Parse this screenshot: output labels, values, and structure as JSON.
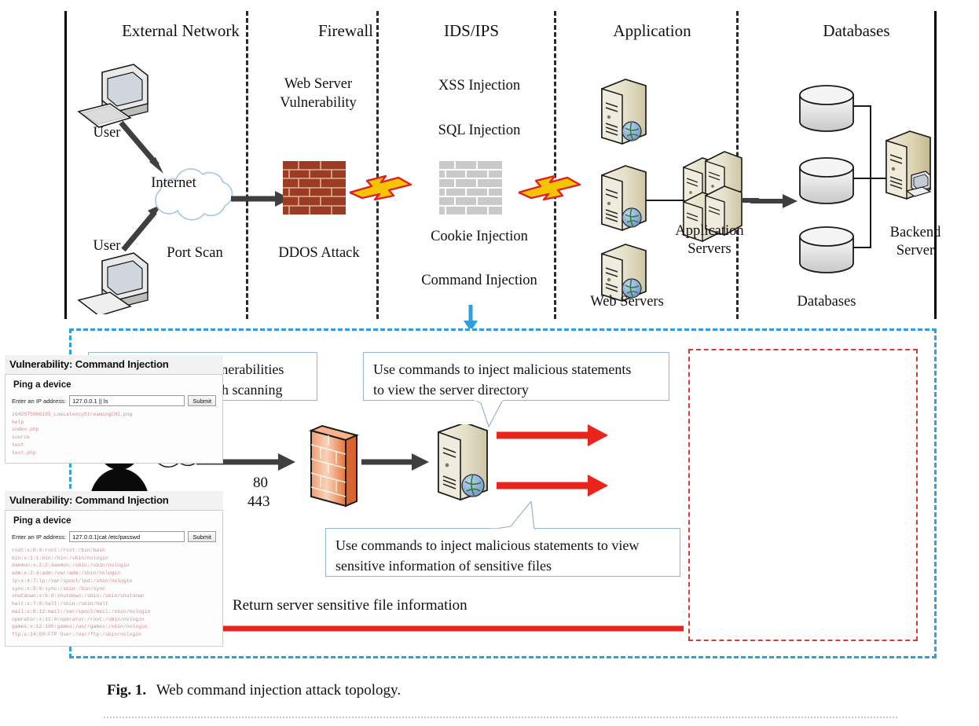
{
  "figure": {
    "label": "Fig. 1",
    "caption": "Web command injection attack topology."
  },
  "top_diagram": {
    "zones": [
      {
        "title": "External Network"
      },
      {
        "title": "Firewall"
      },
      {
        "title": "IDS/IPS"
      },
      {
        "title": "Application"
      },
      {
        "title": "Databases"
      }
    ],
    "labels": {
      "user_top": "User",
      "user_bottom": "User",
      "internet": "Internet",
      "port_scan": "Port Scan",
      "web_server_vulnerability_l1": "Web Server",
      "web_server_vulnerability_l2": "Vulnerability",
      "ddos_attack": "DDOS Attack",
      "xss_injection": "XSS  Injection",
      "sql_injection": "SQL Injection",
      "cookie_injection": "Cookie Injection",
      "command_injection": "Command Injection",
      "web_servers": "Web Servers",
      "application_servers_l1": "Application",
      "application_servers_l2": "Servers",
      "databases": "Databases",
      "backend_server_l1": "Backend",
      "backend_server_l2": "Server"
    }
  },
  "bottom_diagram": {
    "callouts": {
      "scanning_l1": "Attackers learn of vulnerabilities",
      "scanning_l2": "in applications through scanning",
      "directory_l1": "Use commands to inject malicious statements",
      "directory_l2": "to view the server directory",
      "sensitive_l1": "Use commands to inject malicious statements to view",
      "sensitive_l2": "sensitive information of sensitive files"
    },
    "labels": {
      "hacker": "Hacker",
      "port_80": "80",
      "port_443": "443",
      "return_info": "Return server sensitive file information"
    }
  },
  "vulnerability_panels": [
    {
      "title": "Vulnerability: Command Injection",
      "subtitle": "Ping a device",
      "field_label": "Enter an IP address:",
      "field_value": "127.0.0.1 || ls",
      "submit_label": "Submit",
      "output": "1642575066185_LowLatencyStreamingCHI.png\nhelp\nindex.php\nsource\ntest\ntest.php"
    },
    {
      "title": "Vulnerability: Command Injection",
      "subtitle": "Ping a device",
      "field_label": "Enter an IP address:",
      "field_value": "127.0.0.1|cat /etc/passwd",
      "submit_label": "Submit",
      "output": "root:x:0:0:root:/root:/bin/bash\nbin:x:1:1:bin:/bin:/sbin/nologin\ndaemon:x:2:2:daemon:/sbin:/sbin/nologin\nadm:x:3:4:adm:/var/adm:/sbin/nologin\nlp:x:4:7:lp:/var/spool/lpd:/sbin/nologin\nsync:x:5:0:sync:/sbin:/bin/sync\nshutdown:x:6:0:shutdown:/sbin:/sbin/shutdown\nhalt:x:7:0:halt:/sbin:/sbin/halt\nmail:x:8:12:mail:/var/spool/mail:/sbin/nologin\noperator:x:11:0:operator:/root:/sbin/nologin\ngames:x:12:100:games:/usr/games:/sbin/nologin\nftp:x:14:50:FTP User:/var/ftp:/sbin/nologin"
    }
  ],
  "colors": {
    "panel_border_blue": "#2f9fe0",
    "vuln_frame_red": "#e03a30",
    "arrow_red": "#e8241c",
    "arrow_dark": "#3f3f3f",
    "firewall_brick": "#9c3d23",
    "ids_wall_gray": "#c9c9c9",
    "callout_border": "#94b4d0",
    "output_text": "#d08b8b"
  }
}
